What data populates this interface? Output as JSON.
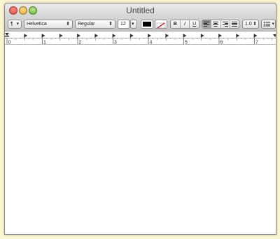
{
  "window": {
    "title": "Untitled"
  },
  "toolbar": {
    "paragraph_style": "¶",
    "font_family": "Helvetica",
    "font_style": "Regular",
    "font_size": "12",
    "text_color": "#000000",
    "bold_label": "B",
    "italic_label": "I",
    "underline_label": "U",
    "line_spacing": "1.0",
    "list_style_icon": "list-bullets-icon"
  },
  "ruler": {
    "numbers": [
      "0",
      "1",
      "2",
      "3",
      "4",
      "5",
      "6",
      "7"
    ]
  },
  "colors": {
    "background": "#fbf6d2",
    "window": "#ffffff",
    "toolbar": "#c9c9c9"
  }
}
